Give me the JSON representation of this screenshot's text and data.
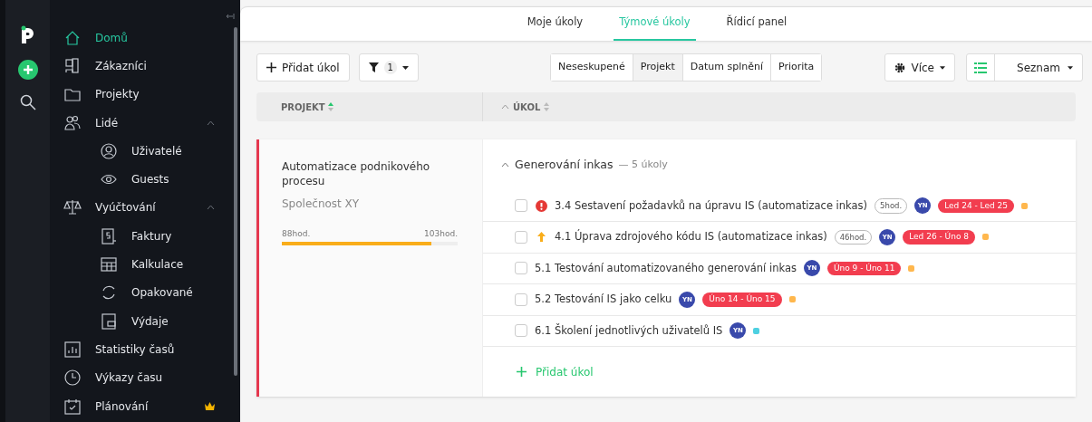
{
  "sidebar": {
    "items": [
      {
        "label": "Domů",
        "selected": true
      },
      {
        "label": "Zákazníci",
        "selected": false
      },
      {
        "label": "Projekty",
        "selected": false
      },
      {
        "label": "Lidé",
        "selected": false,
        "expanded": true,
        "children": [
          {
            "label": "Uživatelé",
            "selected": false
          },
          {
            "label": "Guests",
            "selected": false
          }
        ]
      },
      {
        "label": "Vyúčtování",
        "selected": false,
        "expanded": true,
        "children": [
          {
            "label": "Faktury",
            "selected": false
          },
          {
            "label": "Kalkulace",
            "selected": false
          },
          {
            "label": "Opakované",
            "selected": false
          },
          {
            "label": "Výdaje",
            "selected": false
          }
        ]
      },
      {
        "label": "Statistiky časů",
        "selected": false
      },
      {
        "label": "Výkazy času",
        "selected": false
      },
      {
        "label": "Plánování",
        "selected": false,
        "premium": true
      }
    ]
  },
  "tabs": [
    {
      "label": "Moje úkoly",
      "selected": false
    },
    {
      "label": "Týmové úkoly",
      "selected": true
    },
    {
      "label": "Řídicí panel",
      "selected": false
    }
  ],
  "toolbar": {
    "add_button": "Přidat úkol",
    "filter_count": "1",
    "grouping": [
      {
        "label": "Neseskupené",
        "selected": false
      },
      {
        "label": "Projekt",
        "selected": true
      },
      {
        "label": "Datum splnění",
        "selected": false
      },
      {
        "label": "Priorita",
        "selected": false
      }
    ],
    "more_button": "Více",
    "view_button": "Seznam"
  },
  "table": {
    "columns": [
      "PROJEKT",
      "ÚKOL"
    ]
  },
  "project": {
    "name": "Automatizace podnikového procesu",
    "client": "Společnost XY",
    "spent": "88hod.",
    "budget": "103hod.",
    "level": 0.85
  },
  "group": {
    "title": "Generování inkas",
    "count": "— 5 úkoly",
    "expanded": true,
    "tasks": [
      {
        "kind": "urgent",
        "title": "3.4 Sestavení požadavků na úpravu IS (automatizace inkas)",
        "hours": "5hod.",
        "assignee": "YN",
        "dates": "Led 24 - Led 25",
        "color": "#ffb74d",
        "checked": false
      },
      {
        "kind": "high",
        "title": "4.1 Úprava zdrojového kódu IS (automatizace inkas)",
        "hours": "46hod.",
        "assignee": "YN",
        "dates": "Led 26 - Úno 8",
        "color": "#ffb74d",
        "checked": false
      },
      {
        "kind": "plain",
        "title": "5.1 Testování automatizovaného generování inkas",
        "assignee": "YN",
        "dates": "Úno 9 - Úno 11",
        "color": "#ffb74d",
        "checked": false
      },
      {
        "kind": "plain",
        "title": "5.2 Testování IS jako celku",
        "assignee": "YN",
        "dates": "Úno 14 - Úno 15",
        "color": "#ffb74d",
        "checked": false
      },
      {
        "kind": "plain",
        "title": "6.1 Školení jednotlivých uživatelů IS",
        "assignee": "YN",
        "color": "#4dd0e1",
        "checked": false
      }
    ],
    "add_task": "Přidat úkol"
  }
}
